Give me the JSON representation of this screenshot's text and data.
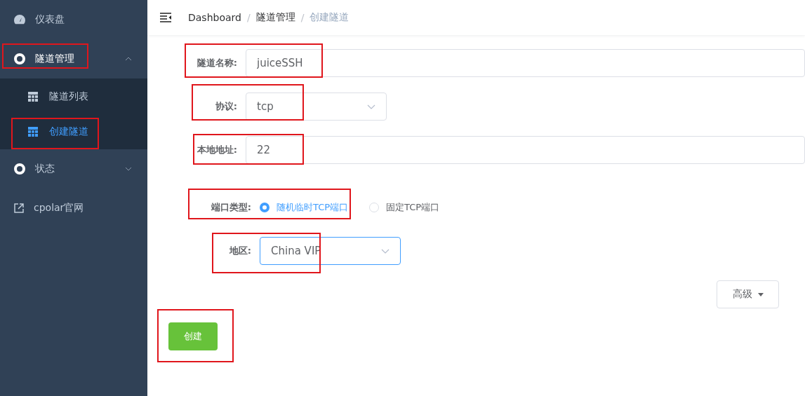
{
  "sidebar": {
    "items": [
      {
        "kind": "icon-dashboard",
        "label": "仪表盘",
        "annotated": false
      },
      {
        "kind": "group",
        "label": "隧道管理",
        "expanded": true,
        "annotated": true,
        "children": [
          {
            "label": "隧道列表",
            "selected": false,
            "annotated": false
          },
          {
            "label": "创建隧道",
            "selected": true,
            "annotated": true
          }
        ]
      },
      {
        "kind": "group",
        "label": "状态",
        "expanded": false,
        "annotated": false
      },
      {
        "kind": "link",
        "label": "cpolar官网",
        "annotated": false
      }
    ]
  },
  "breadcrumb": [
    {
      "kind": "item",
      "label": "Dashboard",
      "current": false
    },
    {
      "kind": "separator",
      "label": "/"
    },
    {
      "kind": "item",
      "label": "隧道管理",
      "current": false
    },
    {
      "kind": "separator",
      "label": "/"
    },
    {
      "kind": "item",
      "label": "创建隧道",
      "current": true
    }
  ],
  "form": {
    "fields": [
      {
        "kind": "input",
        "label": "隧道名称:",
        "value": "juiceSSH",
        "annotated": true
      },
      {
        "kind": "select",
        "label": "协议:",
        "value": "tcp",
        "focused": false,
        "annotated": true
      },
      {
        "kind": "input",
        "label": "本地地址:",
        "value": "22",
        "annotated": true
      },
      {
        "kind": "radio",
        "label": "端口类型:",
        "annotated": true,
        "options": [
          {
            "label": "随机临时TCP端口",
            "selected": true
          },
          {
            "label": "固定TCP端口",
            "selected": false
          }
        ]
      },
      {
        "kind": "select",
        "label": "地区:",
        "value": "China VIP",
        "focused": true,
        "annotated": true
      }
    ],
    "advanced_button": "高级",
    "submit": {
      "label": "创建",
      "annotated": true
    }
  }
}
